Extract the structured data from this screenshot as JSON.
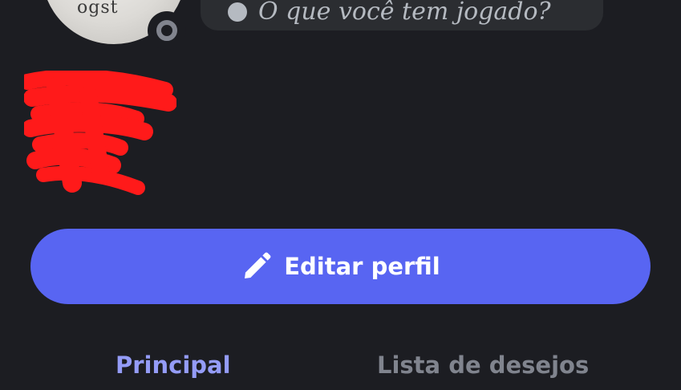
{
  "profile": {
    "avatar_text": "ogst",
    "status_text": "O que você tem jogado?",
    "display_name": "",
    "handle": "",
    "separator": "•",
    "badge_glyph": "✳"
  },
  "actions": {
    "edit_profile_label": "Editar perfil"
  },
  "tabs": [
    {
      "label": "Principal",
      "active": true
    },
    {
      "label": "Lista de desejos",
      "active": false
    }
  ],
  "colors": {
    "background": "#1c1d22",
    "accent": "#5865f2",
    "active_tab": "#949cf7",
    "inactive_tab": "#80848e",
    "redaction": "#ff1a1a"
  },
  "icons": {
    "edit": "pencil-icon",
    "status": "offline-status-icon",
    "badge": "sparkle-icon"
  }
}
